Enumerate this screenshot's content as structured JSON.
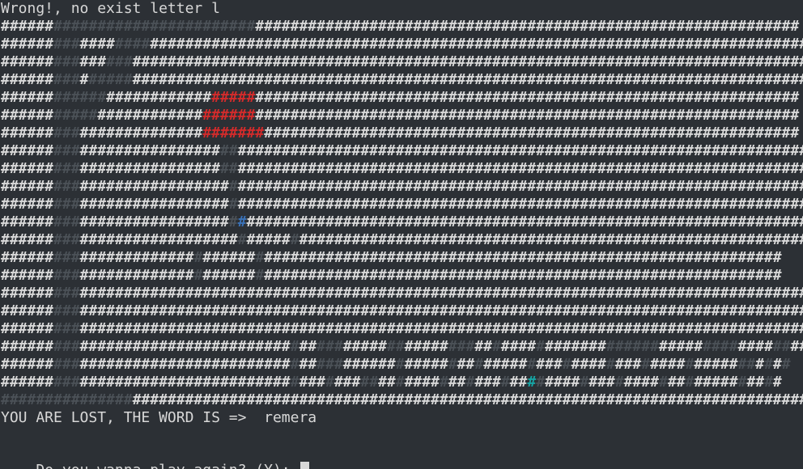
{
  "terminal": {
    "colors": {
      "background": "#2c3035",
      "text": "#d8d8d8",
      "dim": "#4b5157",
      "red": "#d42b2b",
      "blue": "#3a72b8",
      "cyan": "#17a5a5"
    },
    "message": "Wrong!, no exist letter l",
    "result_label": "YOU ARE LOST, THE WORD IS =>  remera",
    "prompt": "Do you wanna play again? (Y): ",
    "art_rows": [
      [
        [
          "l",
          "######"
        ],
        [
          "d",
          "#######################"
        ],
        [
          "l",
          "##############################################################"
        ]
      ],
      [
        [
          "l",
          "######"
        ],
        [
          "d",
          "###"
        ],
        [
          "l",
          "####"
        ],
        [
          "d",
          "####"
        ],
        [
          "l",
          "#####################################################################################"
        ]
      ],
      [
        [
          "l",
          "######"
        ],
        [
          "d",
          "###"
        ],
        [
          "l",
          "###"
        ],
        [
          "d",
          "###"
        ],
        [
          "l",
          "#######################################################################################"
        ]
      ],
      [
        [
          "l",
          "######"
        ],
        [
          "d",
          "###"
        ],
        [
          "l",
          "#"
        ],
        [
          "d",
          "#####"
        ],
        [
          "l",
          "#######################################################################################"
        ]
      ],
      [
        [
          "l",
          "######"
        ],
        [
          "d",
          "######"
        ],
        [
          "l",
          "############"
        ],
        [
          "r",
          "#####"
        ],
        [
          "l",
          "##############################################################"
        ]
      ],
      [
        [
          "l",
          "######"
        ],
        [
          "d",
          "#####"
        ],
        [
          "l",
          "############"
        ],
        [
          "r",
          "######"
        ],
        [
          "l",
          "##############################################################"
        ]
      ],
      [
        [
          "l",
          "######"
        ],
        [
          "d",
          "###"
        ],
        [
          "l",
          "##############"
        ],
        [
          "r",
          "#######"
        ],
        [
          "l",
          "#############################################################"
        ]
      ],
      [
        [
          "l",
          "######"
        ],
        [
          "d",
          "###"
        ],
        [
          "l",
          "################"
        ],
        [
          "d",
          "##"
        ],
        [
          "l",
          "#################################################################"
        ]
      ],
      [
        [
          "l",
          "######"
        ],
        [
          "d",
          "###"
        ],
        [
          "l",
          "################"
        ],
        [
          "d",
          "##"
        ],
        [
          "l",
          "#################################################################"
        ]
      ],
      [
        [
          "l",
          "######"
        ],
        [
          "d",
          "###"
        ],
        [
          "l",
          "#################"
        ],
        [
          "d",
          "#"
        ],
        [
          "l",
          "#################################################################"
        ]
      ],
      [
        [
          "l",
          "######"
        ],
        [
          "d",
          "###"
        ],
        [
          "l",
          "#################"
        ],
        [
          "d",
          "#"
        ],
        [
          "l",
          "#################################################################"
        ]
      ],
      [
        [
          "l",
          "######"
        ],
        [
          "d",
          "###"
        ],
        [
          "l",
          "#################"
        ],
        [
          "d",
          "#"
        ],
        [
          "b",
          "#"
        ],
        [
          "l",
          "################################################################"
        ]
      ],
      [
        [
          "l",
          "######"
        ],
        [
          "d",
          "###"
        ],
        [
          "l",
          "##################"
        ],
        [
          "d",
          "#"
        ],
        [
          "l",
          "#####"
        ],
        [
          "d",
          "#"
        ],
        [
          "l",
          "###########################################################"
        ]
      ],
      [
        [
          "l",
          "######"
        ],
        [
          "d",
          "###"
        ],
        [
          "l",
          "#############"
        ],
        [
          "d",
          "#"
        ],
        [
          "l",
          "######"
        ],
        [
          "d",
          "#"
        ],
        [
          "l",
          "###########################################################"
        ]
      ],
      [
        [
          "l",
          "######"
        ],
        [
          "d",
          "###"
        ],
        [
          "l",
          "#############"
        ],
        [
          "d",
          "#"
        ],
        [
          "l",
          "######"
        ],
        [
          "d",
          "#"
        ],
        [
          "l",
          "###########################################################"
        ]
      ],
      [
        [
          "l",
          "######"
        ],
        [
          "d",
          "###"
        ],
        [
          "l",
          "##########################################################################################"
        ]
      ],
      [
        [
          "l",
          "######"
        ],
        [
          "d",
          "###"
        ],
        [
          "l",
          "##########################################################################################"
        ]
      ],
      [
        [
          "l",
          "######"
        ],
        [
          "d",
          "###"
        ],
        [
          "l",
          "##########################################################################################"
        ]
      ],
      [
        [
          "l",
          "######"
        ],
        [
          "d",
          "###"
        ],
        [
          "l",
          "########################"
        ],
        [
          "d",
          "#"
        ],
        [
          "l",
          "##"
        ],
        [
          "d",
          "###"
        ],
        [
          "l",
          "#####"
        ],
        [
          "d",
          "##"
        ],
        [
          "l",
          "#####"
        ],
        [
          "d",
          "###"
        ],
        [
          "l",
          "##"
        ],
        [
          "d",
          "#"
        ],
        [
          "l",
          "####"
        ],
        [
          "d",
          "#"
        ],
        [
          "l",
          "#######"
        ],
        [
          "d",
          "######"
        ],
        [
          "l",
          "#####"
        ],
        [
          "d",
          "####"
        ],
        [
          "l",
          "####"
        ],
        [
          "d",
          "##"
        ],
        [
          "l",
          "##"
        ],
        [
          "d",
          "#"
        ]
      ],
      [
        [
          "l",
          "######"
        ],
        [
          "d",
          "###"
        ],
        [
          "l",
          "########################"
        ],
        [
          "d",
          "#"
        ],
        [
          "l",
          "##"
        ],
        [
          "d",
          "###"
        ],
        [
          "l",
          "######"
        ],
        [
          "d",
          "#"
        ],
        [
          "l",
          "#####"
        ],
        [
          "d",
          "#"
        ],
        [
          "l",
          "##"
        ],
        [
          "d",
          "#"
        ],
        [
          "l",
          "#####"
        ],
        [
          "d",
          "#"
        ],
        [
          "l",
          "###"
        ],
        [
          "d",
          "#"
        ],
        [
          "l",
          "####"
        ],
        [
          "d",
          "#"
        ],
        [
          "l",
          "###"
        ],
        [
          "d",
          "#"
        ],
        [
          "l",
          "####"
        ],
        [
          "d",
          "#"
        ],
        [
          "l",
          "#####"
        ],
        [
          "d",
          "##"
        ],
        [
          "l",
          "#"
        ],
        [
          "d",
          "#"
        ],
        [
          "l",
          "#"
        ],
        [
          "d",
          "#"
        ]
      ],
      [
        [
          "l",
          "######"
        ],
        [
          "d",
          "###"
        ],
        [
          "l",
          "########################"
        ],
        [
          "d",
          "#"
        ],
        [
          "l",
          "###"
        ],
        [
          "d",
          "#"
        ],
        [
          "l",
          "###"
        ],
        [
          "d",
          "##"
        ],
        [
          "l",
          "##"
        ],
        [
          "d",
          "#"
        ],
        [
          "l",
          "####"
        ],
        [
          "d",
          "#"
        ],
        [
          "l",
          "##"
        ],
        [
          "d",
          "#"
        ],
        [
          "l",
          "###"
        ],
        [
          "d",
          "#"
        ],
        [
          "l",
          "##"
        ],
        [
          "c",
          "#"
        ],
        [
          "d",
          "#"
        ],
        [
          "l",
          "####"
        ],
        [
          "d",
          "#"
        ],
        [
          "l",
          "###"
        ],
        [
          "d",
          "#"
        ],
        [
          "l",
          "####"
        ],
        [
          "d",
          "#"
        ],
        [
          "l",
          "##"
        ],
        [
          "d",
          "#"
        ],
        [
          "l",
          "#####"
        ],
        [
          "d",
          "#"
        ],
        [
          "l",
          "##"
        ],
        [
          "d",
          "#"
        ],
        [
          "l",
          "#"
        ]
      ],
      [
        [
          "d",
          "###############"
        ],
        [
          "l",
          "##########################################################################################"
        ]
      ]
    ]
  }
}
